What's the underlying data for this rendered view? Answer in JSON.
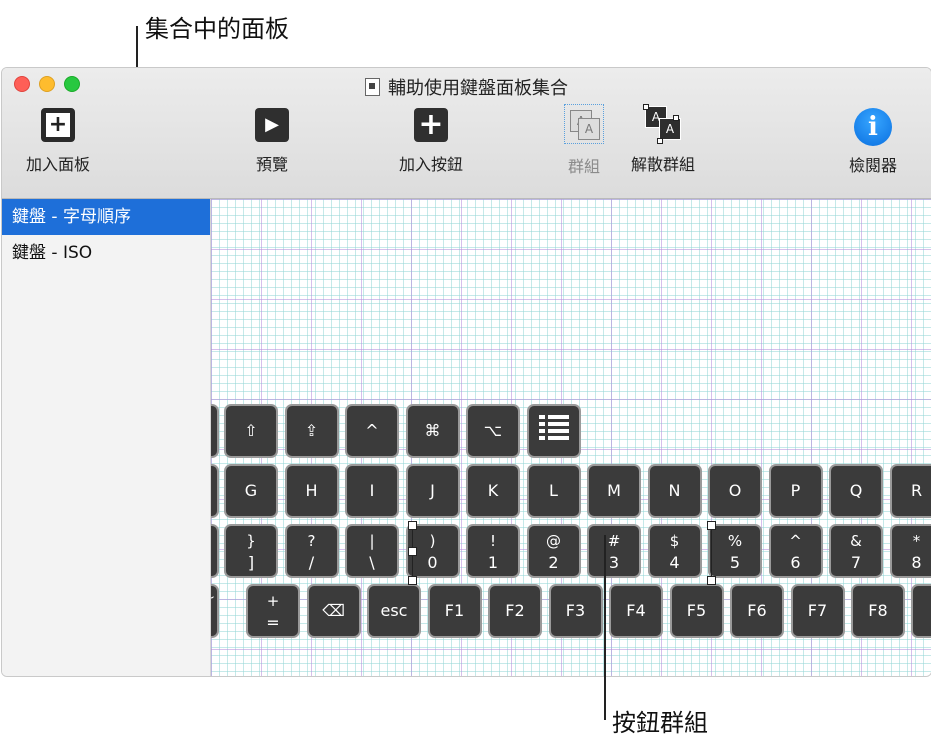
{
  "callouts": {
    "top_label": "集合中的面板",
    "bottom_label": "按鈕群組"
  },
  "window": {
    "title": "輔助使用鍵盤面板集合"
  },
  "toolbar": {
    "add_panel": "加入面板",
    "preview": "預覽",
    "add_button": "加入按鈕",
    "group": "群組",
    "ungroup": "解散群組",
    "inspector": "檢閱器",
    "add_panel_icon": "plus-square-icon",
    "preview_icon": "play-icon",
    "add_button_icon": "plus-icon",
    "group_icon": "group-icon",
    "ungroup_icon": "ungroup-icon",
    "inspector_icon": "info-icon"
  },
  "sidebar": {
    "items": [
      {
        "label": "鍵盤 - 字母順序",
        "selected": true
      },
      {
        "label": "鍵盤 - ISO",
        "selected": false
      }
    ]
  },
  "keyboard": {
    "row1": [
      "⇧",
      "⇪",
      "^",
      "⌘",
      "⌥",
      "list-icon"
    ],
    "row2": [
      "G",
      "H",
      "I",
      "J",
      "K",
      "L",
      "M",
      "N",
      "O",
      "P",
      "Q",
      "R"
    ],
    "row3": [
      {
        "top": "}",
        "bottom": "]"
      },
      {
        "top": "?",
        "bottom": "/"
      },
      {
        "top": "|",
        "bottom": "\\"
      },
      {
        "top": ")",
        "bottom": "0"
      },
      {
        "top": "!",
        "bottom": "1"
      },
      {
        "top": "@",
        "bottom": "2"
      },
      {
        "top": "#",
        "bottom": "3"
      },
      {
        "top": "$",
        "bottom": "4"
      },
      {
        "top": "%",
        "bottom": "5"
      },
      {
        "top": "^",
        "bottom": "6"
      },
      {
        "top": "&",
        "bottom": "7"
      },
      {
        "top": "*",
        "bottom": "8"
      }
    ],
    "row4_edge": "~",
    "row4": [
      {
        "top": "+",
        "bottom": "="
      },
      {
        "label": "⌫"
      },
      {
        "label": "esc"
      },
      {
        "label": "F1"
      },
      {
        "label": "F2"
      },
      {
        "label": "F3"
      },
      {
        "label": "F4"
      },
      {
        "label": "F5"
      },
      {
        "label": "F6"
      },
      {
        "label": "F7"
      },
      {
        "label": "F8"
      }
    ]
  }
}
